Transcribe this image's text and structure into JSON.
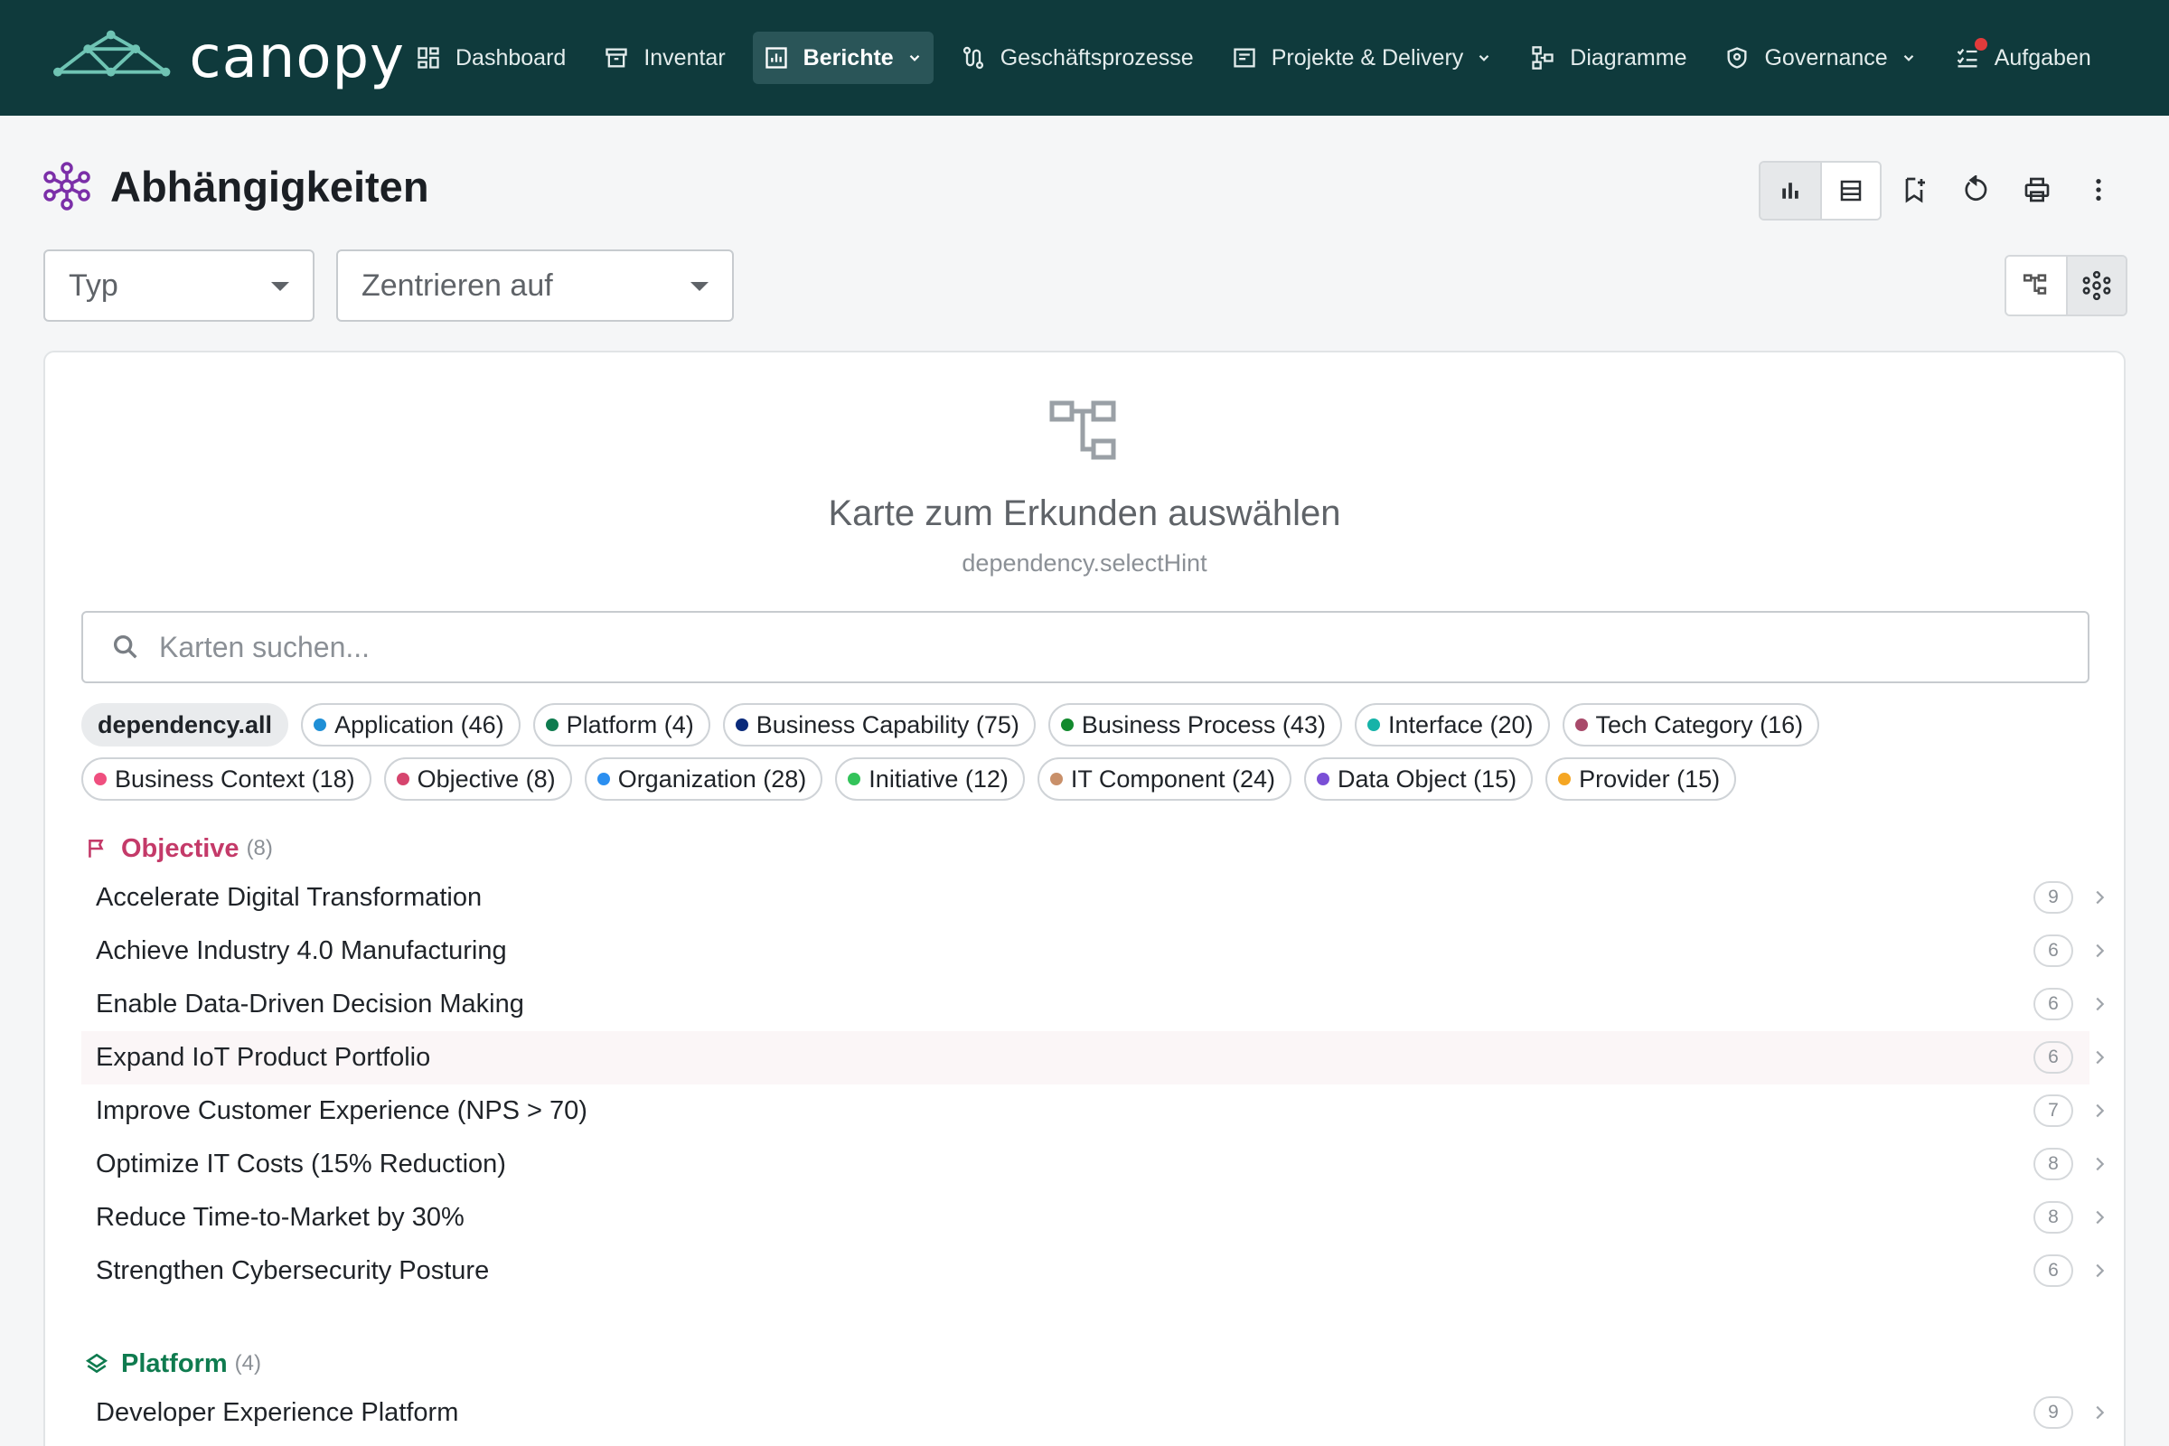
{
  "brand": {
    "name": "canopy"
  },
  "nav": [
    {
      "label": "Dashboard",
      "icon": "dashboard-icon"
    },
    {
      "label": "Inventar",
      "icon": "archive-icon"
    },
    {
      "label": "Berichte",
      "icon": "report-chart-icon",
      "active": true,
      "dropdown": true
    },
    {
      "label": "Geschäftsprozesse",
      "icon": "process-flow-icon"
    },
    {
      "label": "Projekte & Delivery",
      "icon": "project-icon",
      "dropdown": true
    },
    {
      "label": "Diagramme",
      "icon": "diagram-icon"
    },
    {
      "label": "Governance",
      "icon": "shield-icon",
      "dropdown": true
    },
    {
      "label": "Aufgaben",
      "icon": "tasks-checklist-icon",
      "notification": true
    }
  ],
  "page": {
    "title": "Abhängigkeiten"
  },
  "filters": {
    "type_placeholder": "Typ",
    "center_placeholder": "Zentrieren auf"
  },
  "empty": {
    "title": "Karte zum Erkunden auswählen",
    "hint": "dependency.selectHint"
  },
  "search": {
    "placeholder": "Karten suchen..."
  },
  "chips": [
    {
      "label": "dependency.all",
      "all": true
    },
    {
      "label": "Application (46)",
      "color": "#1f8fd6"
    },
    {
      "label": "Platform (4)",
      "color": "#0f7b4f"
    },
    {
      "label": "Business Capability (75)",
      "color": "#0a2a7a"
    },
    {
      "label": "Business Process (43)",
      "color": "#138a2e"
    },
    {
      "label": "Interface (20)",
      "color": "#16b3a8"
    },
    {
      "label": "Tech Category (16)",
      "color": "#a84a6a"
    },
    {
      "label": "Business Context (18)",
      "color": "#ef4f7f"
    },
    {
      "label": "Objective (8)",
      "color": "#d6456e"
    },
    {
      "label": "Organization (28)",
      "color": "#2b8ff0"
    },
    {
      "label": "Initiative (12)",
      "color": "#33c35a"
    },
    {
      "label": "IT Component (24)",
      "color": "#c9906a"
    },
    {
      "label": "Data Object (15)",
      "color": "#7a4fd6"
    },
    {
      "label": "Provider (15)",
      "color": "#f5a623"
    }
  ],
  "sections": [
    {
      "name": "Objective",
      "count": "(8)",
      "color": "#c43a69",
      "icon": "flag-icon",
      "items": [
        {
          "label": "Accelerate Digital Transformation",
          "count": "9"
        },
        {
          "label": "Achieve Industry 4.0 Manufacturing",
          "count": "6"
        },
        {
          "label": "Enable Data-Driven Decision Making",
          "count": "6"
        },
        {
          "label": "Expand IoT Product Portfolio",
          "count": "6",
          "hover": true
        },
        {
          "label": "Improve Customer Experience (NPS > 70)",
          "count": "7"
        },
        {
          "label": "Optimize IT Costs (15% Reduction)",
          "count": "8"
        },
        {
          "label": "Reduce Time-to-Market by 30%",
          "count": "8"
        },
        {
          "label": "Strengthen Cybersecurity Posture",
          "count": "6"
        }
      ]
    },
    {
      "name": "Platform",
      "count": "(4)",
      "color": "#0f7b4f",
      "icon": "layers-icon",
      "items": [
        {
          "label": "Developer Experience Platform",
          "count": "9"
        }
      ]
    }
  ]
}
